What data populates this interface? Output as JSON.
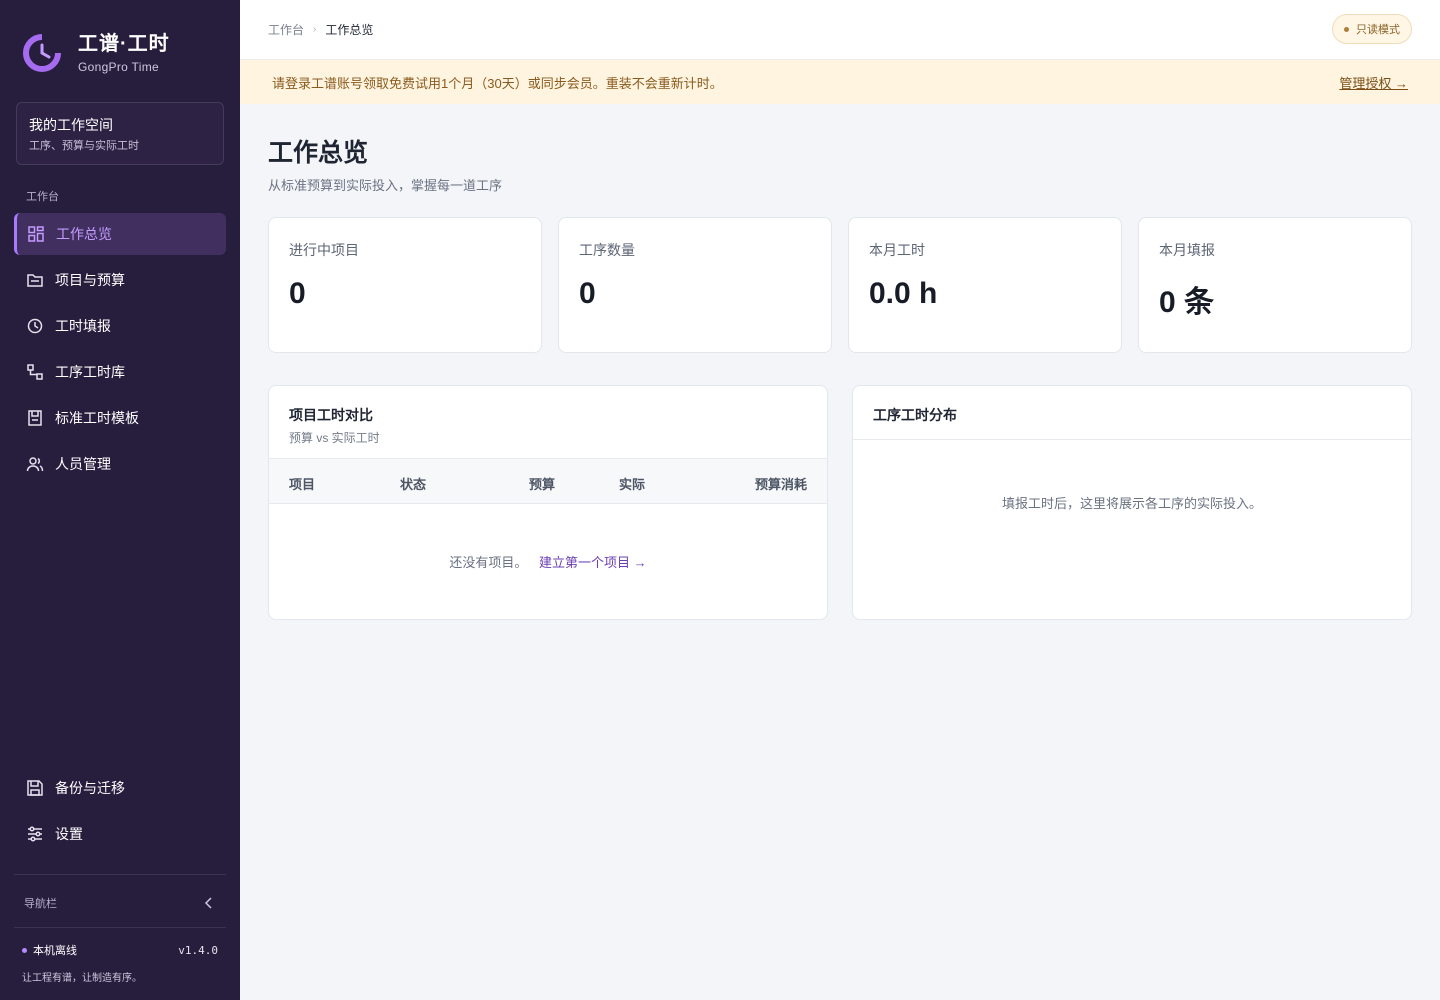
{
  "brand": {
    "title": "工谱·工时",
    "subtitle": "GongPro Time"
  },
  "workspace": {
    "title": "我的工作空间",
    "subtitle": "工序、预算与实际工时"
  },
  "nav": {
    "group_label": "工作台",
    "items": [
      {
        "label": "工作总览",
        "icon": "dashboard-icon",
        "active": true
      },
      {
        "label": "项目与预算",
        "icon": "folder-icon"
      },
      {
        "label": "工时填报",
        "icon": "clock-icon"
      },
      {
        "label": "工序工时库",
        "icon": "flow-icon"
      },
      {
        "label": "标准工时模板",
        "icon": "template-icon"
      },
      {
        "label": "人员管理",
        "icon": "users-icon"
      }
    ],
    "bottom_items": [
      {
        "label": "备份与迁移",
        "icon": "save-icon"
      },
      {
        "label": "设置",
        "icon": "sliders-icon"
      }
    ],
    "collapse_label": "导航栏"
  },
  "status": {
    "offline": "本机离线",
    "version": "v1.4.0",
    "slogan": "让工程有谱，让制造有序。"
  },
  "topbar": {
    "breadcrumb_root": "工作台",
    "breadcrumb_current": "工作总览",
    "readonly": "只读模式"
  },
  "banner": {
    "text": "请登录工谱账号领取免费试用1个月（30天）或同步会员。重装不会重新计时。",
    "link": "管理授权 →"
  },
  "page": {
    "title": "工作总览",
    "subtitle": "从标准预算到实际投入，掌握每一道工序"
  },
  "stats": [
    {
      "label": "进行中项目",
      "value": "0"
    },
    {
      "label": "工序数量",
      "value": "0"
    },
    {
      "label": "本月工时",
      "value": "0.0 h"
    },
    {
      "label": "本月填报",
      "value": "0 条"
    }
  ],
  "compare": {
    "title": "项目工时对比",
    "subtitle": "预算 vs 实际工时",
    "columns": [
      "项目",
      "状态",
      "预算",
      "实际",
      "预算消耗"
    ],
    "empty": "还没有项目。",
    "empty_link": "建立第一个项目 →"
  },
  "distribution": {
    "title": "工序工时分布",
    "empty": "填报工时后，这里将展示各工序的实际投入。"
  },
  "colors": {
    "sidebar": "#271d3d",
    "accent": "#a97aff",
    "banner": "#fff4df"
  }
}
